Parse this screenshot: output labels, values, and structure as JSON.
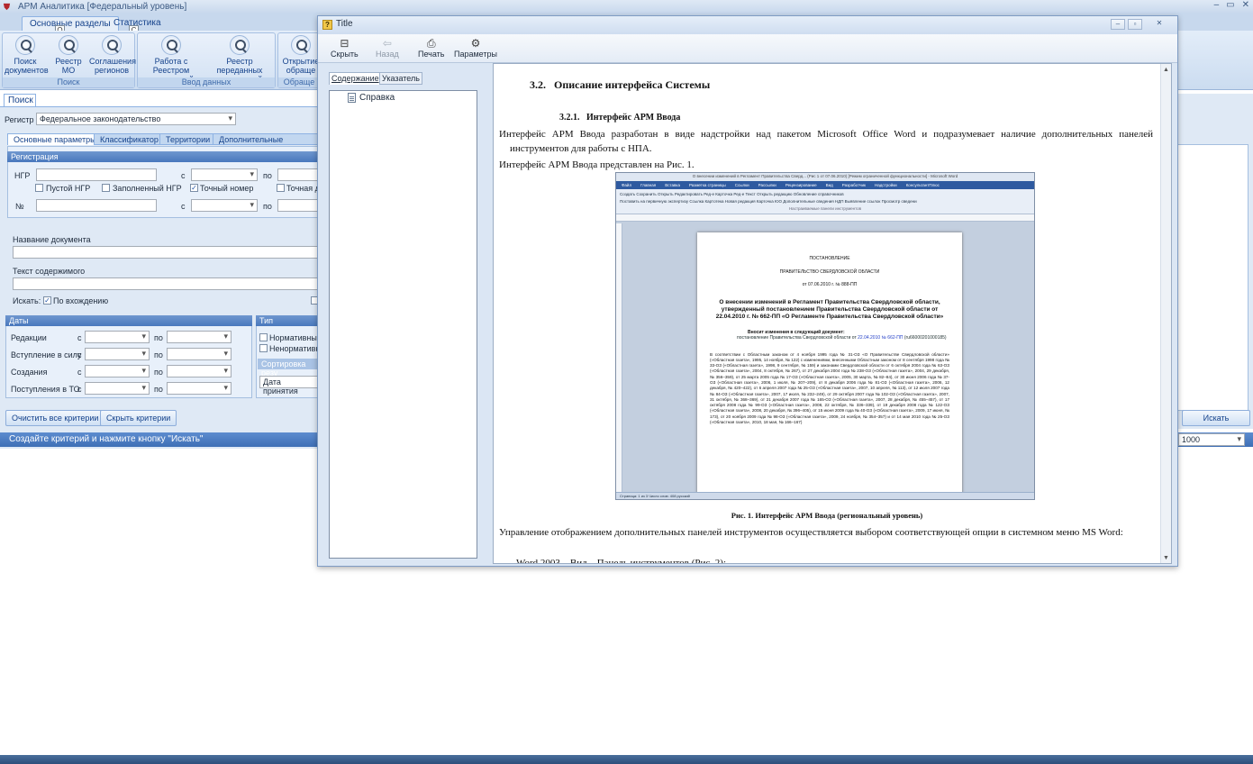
{
  "window": {
    "title": "АРМ Аналитика [Федеральный уровень]",
    "controls": [
      "–",
      "▭",
      "✕"
    ]
  },
  "ribbon": {
    "tabs": [
      {
        "label": "Основные разделы",
        "keytip": "О"
      },
      {
        "label": "Статистика",
        "keytip": "С"
      }
    ],
    "groups": [
      {
        "label": "Поиск",
        "buttons": [
          "Поиск\nдокументов",
          "Реестр МО",
          "Соглашения\nрегионов"
        ]
      },
      {
        "label": "Ввод данных",
        "buttons": [
          "Работа с Реестром\nсоглашений",
          "Реестр переданных\nполномочий"
        ]
      },
      {
        "label": "Обраще",
        "buttons": [
          "Открытие\nобраще"
        ]
      }
    ]
  },
  "search": {
    "tab_label": "Поиск",
    "registry_label": "Регистр",
    "registry_value": "Федеральное законодательство",
    "subtabs": [
      "Основные параметры",
      "Классификатор",
      "Территории",
      "Дополнительные сведения"
    ],
    "registration": {
      "header": "Регистрация",
      "ngr_label": "НГР",
      "from": "с",
      "to": "по",
      "checks": [
        {
          "label": "Пустой НГР",
          "checked": false
        },
        {
          "label": "Заполненный НГР",
          "checked": false
        },
        {
          "label": "Точный номер",
          "checked": true
        },
        {
          "label": "Точная д",
          "checked": false
        }
      ],
      "num_label": "№"
    },
    "doc_name_label": "Название документа",
    "content_label": "Текст содержимого",
    "search_by_label": "Искать:",
    "search_by_value": "По вхождению",
    "dates": {
      "header": "Даты",
      "rows": [
        "Редакции",
        "Вступление в силу",
        "Создания",
        "Поступления в ТО"
      ],
      "from": "с",
      "to": "по"
    },
    "type": {
      "header": "Тип",
      "options": [
        "Нормативный",
        "Ненормативны"
      ]
    },
    "sort": {
      "header": "Сортировка резу",
      "value": "Дата принятия"
    },
    "clear_button": "Очистить все критерии",
    "hide_button": "Скрыть критерии",
    "status_text": "Создайте критерий и нажмите кнопку \"Искать\"",
    "search_button": "Искать",
    "limit_value": "1000"
  },
  "help": {
    "title": "Title",
    "toolbar": [
      {
        "label": "Скрыть",
        "icon": "hide-icon",
        "glyph": "⊟",
        "enabled": true
      },
      {
        "label": "Назад",
        "icon": "back-arrow-icon",
        "glyph": "⇦",
        "enabled": false
      },
      {
        "label": "Печать",
        "icon": "printer-icon",
        "glyph": "⎙",
        "enabled": true
      },
      {
        "label": "Параметры",
        "icon": "options-icon",
        "glyph": "⚙",
        "enabled": true
      }
    ],
    "nav_tabs": [
      "Содержание",
      "Указатель"
    ],
    "tree": [
      {
        "label": "Справка"
      }
    ],
    "content": {
      "heading": "3.2.   Описание интерфейса Системы",
      "subheading": "3.2.1.   Интерфейс АРМ Ввода",
      "para1": "Интерфейс АРМ Ввода разработан в виде надстройки над пакетом Microsoft Office Word и подразумевает наличие дополнительных панелей инструментов для работы с НПА.",
      "para2": "Интерфейс АРМ Ввода представлен на Рис. 1.",
      "caption": "Рис. 1. Интерфейс АРМ Ввода (региональный уровень)",
      "para3": "Управление отображением дополнительных панелей инструментов осуществляется выбором соответствующей опции в системном меню MS Word:",
      "para4": "–  Word 2003 – Вид – Панель инструментов (Рис. 2):"
    },
    "figure": {
      "title": "О внесении изменений в Регламент Правительства Сверд... (Рис 1 от 07.06.2010) [Режим ограниченной функциональности] - Microsoft Word",
      "tabs": [
        "Файл",
        "Главная",
        "Вставка",
        "Разметка страницы",
        "Ссылки",
        "Рассылки",
        "Рецензирование",
        "Вид",
        "Разработчик",
        "Надстройки",
        "КонсультантПлюс"
      ],
      "ribbon_line1": "Создать  Сохранить  Открыть  Редактировать  Ред-е  Карточка  Ред-е  Текст  Открыть редакцию  Обновление справочников",
      "ribbon_line2": "Поставить на первичную экспертизу  Ссылка  Картотека  Новая редакция  Карточка ЮО  Дополнительные сведения  НДП  Выявление ссылок  Просмотр сведени",
      "ribbon_group": "Настраиваемые панели инструментов",
      "doc_title": "ПОСТАНОВЛЕНИЕ",
      "doc_org": "ПРАВИТЕЛЬСТВО СВЕРДЛОВСКОЙ ОБЛАСТИ",
      "doc_date": "от 07.06.2010 г. № 888-ПП",
      "doc_heading": "О внесении изменений в Регламент Правительства Свердловской области, утвержденный постановлением Правительства Свердловской области от 22.04.2010 г. № 662-ПП «О Регламенте Правительства Свердловской области»",
      "doc_intro": "Вносит изменения в следующий документ:",
      "doc_ref_prefix": "постановление Правительства Свердловской области от ",
      "doc_ref_link": "22.04.2010 № 662-ПП",
      "doc_ref_suffix": " (ru66000201000185)",
      "doc_body": "В соответствии с Областным законом от 4 ноября 1995 года № 31-ОЗ «О Правительстве Свердловской области» («Областная газета», 1995, 14 ноября, № 122) с изменениями, внесенными Областным законом от 8 сентября 1998 года № 33-ОЗ («Областная газета», 1998, 9 сентября, № 159) и законами Свердловской области от 6 октября 2004 года № 63-ОЗ («Областная газета», 2004, 8 октября, № 267), от 27 декабря 2004 года № 238-ОЗ («Областная газета», 2004, 29 декабря, № 356–359), от 25 марта 2005 года № 17-ОЗ («Областная газета», 2005, 30 марта, № 82–84), от 30 июня 2006 года № 37-ОЗ («Областная газета», 2006, 1 июля, № 207–209), от 8 декабря 2006 года № 81-ОЗ («Областная газета», 2006, 12 декабря, № 420–422), от 6 апреля 2007 года № 25-ОЗ («Областная газета», 2007, 10 апреля, № 113), от 12 июля 2007 года № 84-ОЗ («Областная газета», 2007, 17 июля, № 232–249), от 29 октября 2007 года № 102-ОЗ («Областная газета», 2007, 31 октября, № 368–369), от 21 декабря 2007 года № 165-ОЗ («Областная газета», 2007, 28 декабря, № 455–457), от 17 октября 2008 года № 99-ОЗ («Областная газета», 2008, 22 октября, № 336–339), от 19 декабря 2008 года № 122-ОЗ («Областная газета», 2008, 20 декабря, № 396–405), от 15 июня 2009 года № 40-ОЗ («Областная газета», 2009, 17 июня, № 173), от 20 ноября 2009 года № 98-ОЗ («Областная газета», 2009, 24 ноября, № 354–357) и от 14 мая 2010 года № 25-ОЗ («Областная газета», 2010, 18 мая, № 166–167)",
      "status": "Страница: 1 из 3   Число слов: 408   русский"
    }
  }
}
